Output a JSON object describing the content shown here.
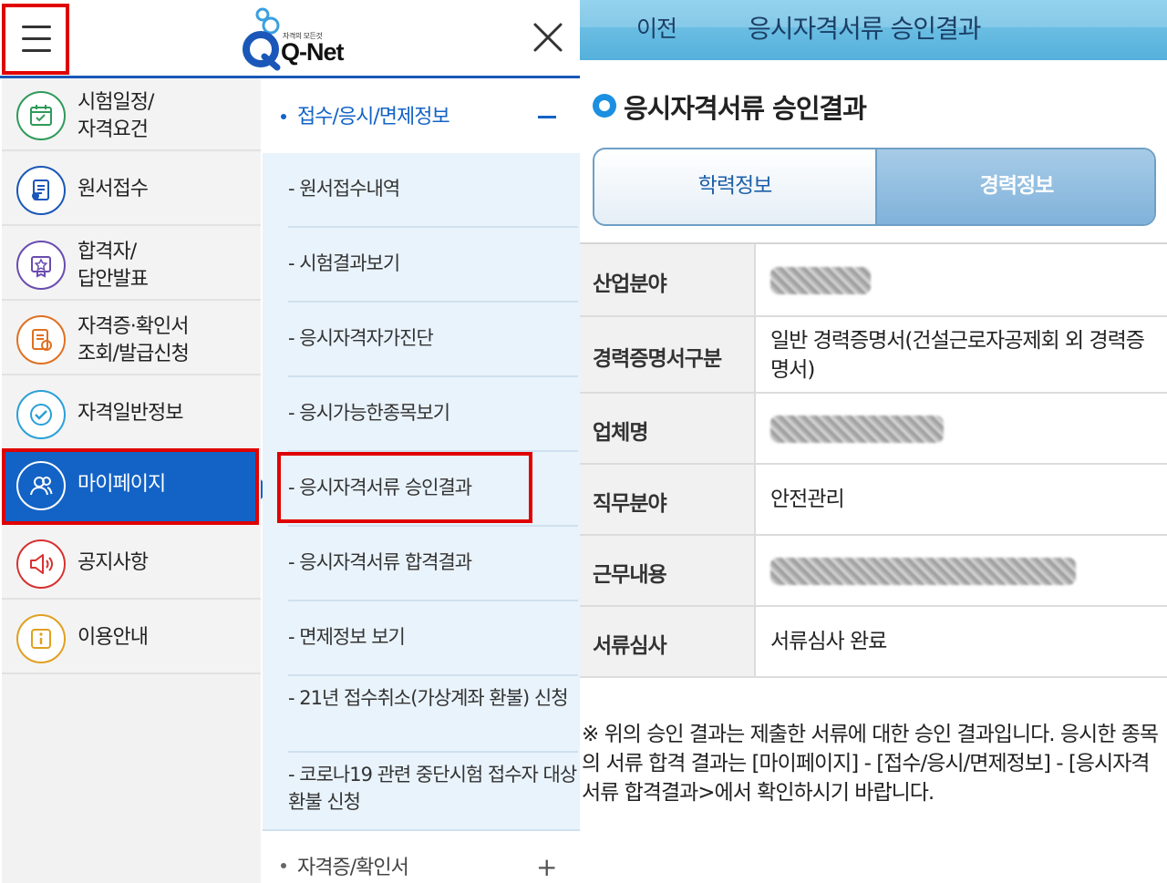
{
  "menu_panel": {
    "logo": {
      "tagline": "자격의 모든것",
      "text": "Q-Net"
    },
    "primary_items": [
      {
        "lines": [
          "시험일정/",
          "자격요건"
        ],
        "icon": "calendar-icon",
        "color": "#2f9a5a"
      },
      {
        "lines": [
          "원서접수"
        ],
        "icon": "document-icon",
        "color": "#1a57b8"
      },
      {
        "lines": [
          "합격자/",
          "답안발표"
        ],
        "icon": "award-icon",
        "color": "#6a4cb0"
      },
      {
        "lines": [
          "자격증·확인서",
          "조회/발급신청"
        ],
        "icon": "certificate-icon",
        "color": "#e07020"
      },
      {
        "lines": [
          "자격일반정보"
        ],
        "icon": "check-circle-icon",
        "color": "#2aa0d8"
      },
      {
        "lines": [
          "마이페이지"
        ],
        "icon": "user-icon",
        "color": "#ffffff"
      },
      {
        "lines": [
          "공지사항"
        ],
        "icon": "megaphone-icon",
        "color": "#d83030"
      },
      {
        "lines": [
          "이용안내"
        ],
        "icon": "info-icon",
        "color": "#e0a020"
      }
    ],
    "active_index": 5,
    "submenu": {
      "header": "접수/응시/면제정보",
      "items": [
        "- 원서접수내역",
        "- 시험결과보기",
        "- 응시자격자가진단",
        "- 응시가능한종목보기",
        "- 응시자격서류 승인결과",
        "- 응시자격서류 합격결과",
        "- 면제정보 보기",
        "- 21년 접수취소(가상계좌 환불) 신청",
        "- 코로나19 관련 중단시험 접수자 대상 환불 신청"
      ],
      "footer": "자격증/확인서",
      "footer_toggle": "+"
    }
  },
  "result_panel": {
    "back_label": "이전",
    "header_title": "응시자격서류 승인결과",
    "section_title": "응시자격서류 승인결과",
    "tabs": {
      "education": "학력정보",
      "career": "경력정보",
      "selected": "경력정보"
    },
    "rows": [
      {
        "label": "산업분야",
        "value": "",
        "redacted": true
      },
      {
        "label": "경력증명서구분",
        "value": "일반 경력증명서(건설근로자공제회 외 경력증명서)"
      },
      {
        "label": "업체명",
        "value": "",
        "redacted": true
      },
      {
        "label": "직무분야",
        "value": "안전관리"
      },
      {
        "label": "근무내용",
        "value": "",
        "redacted": true
      },
      {
        "label": "서류심사",
        "value": "서류심사 완료"
      }
    ],
    "note": "※ 위의 승인 결과는 제출한 서류에 대한 승인 결과입니다. 응시한 종목의 서류 합격 결과는 [마이페이지] - [접수/응시/면제정보] - [응시자격서류 합격결과>에서 확인하시기 바랍니다."
  }
}
